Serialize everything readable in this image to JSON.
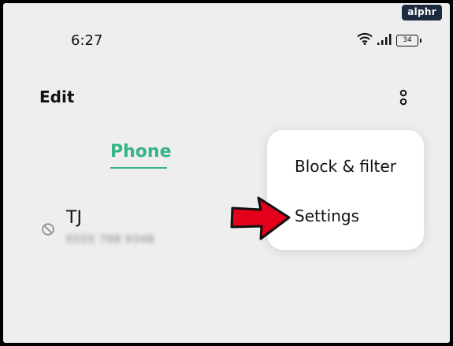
{
  "watermark": {
    "text": "alphr"
  },
  "status_bar": {
    "time": "6:27",
    "icons": [
      "wifi-icon",
      "signal-icon",
      "battery-icon"
    ],
    "battery_level": "34"
  },
  "header": {
    "edit_label": "Edit",
    "more_icon": "more-vertical-icon"
  },
  "tabs": [
    {
      "label": "Phone",
      "active": true
    }
  ],
  "contacts": [
    {
      "name": "TJ",
      "number": "0555 798 9348",
      "blocked_icon": "block-icon"
    }
  ],
  "menu": {
    "items": [
      {
        "label": "Block & filter"
      },
      {
        "label": "Settings"
      }
    ]
  },
  "annotation": {
    "icon": "red-arrow-icon",
    "color": "#e3001b"
  },
  "colors": {
    "accent": "#33b585",
    "background": "#eeeeee",
    "menu_background": "#ffffff"
  }
}
